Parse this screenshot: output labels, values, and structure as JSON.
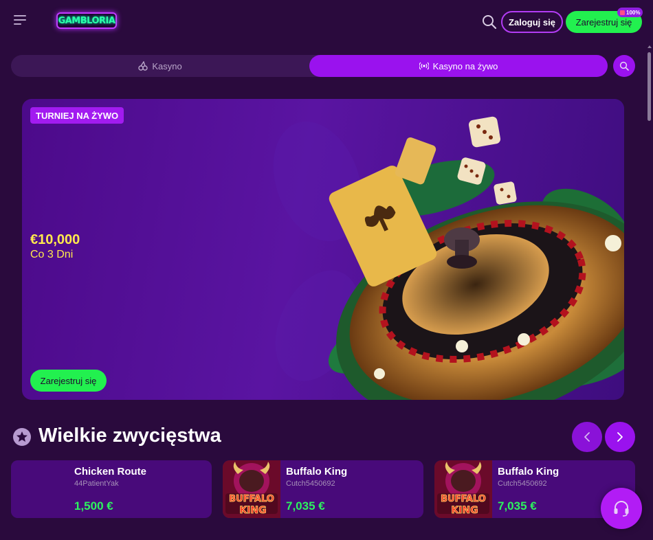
{
  "header": {
    "logo_text": "GAMBLORIA",
    "menu_icon": "menu-icon",
    "search_icon": "search-icon",
    "login_label": "Zaloguj się",
    "register_label": "Zarejestruj się",
    "promo_badge": "100%"
  },
  "tabs": {
    "casino_label": "Kasyno",
    "live_label": "Kasyno na żywo",
    "active": "Kasyno na żywo"
  },
  "hero": {
    "badge": "TURNIEJ NA ŻYWO",
    "amount": "€10,000",
    "subtitle": "Co 3 Dni",
    "cta_label": "Zarejestruj się"
  },
  "big_wins": {
    "title": "Wielkie zwycięstwa",
    "cards": [
      {
        "game": "Chicken Route",
        "user": "44PatientYak",
        "amount": "1,500 €"
      },
      {
        "game": "Buffalo King",
        "user": "Cutch5450692",
        "amount": "7,035 €"
      },
      {
        "game": "Buffalo King",
        "user": "Cutch5450692",
        "amount": "7,035 €"
      }
    ],
    "thumb_logo_line1": "BUFFALO",
    "thumb_logo_line2": "KING"
  },
  "colors": {
    "background": "#2a0a3d",
    "accent": "#9a12ee",
    "cta_green": "#22f04f",
    "win_green": "#2cf35e",
    "highlight_yellow": "#ffe94d"
  }
}
